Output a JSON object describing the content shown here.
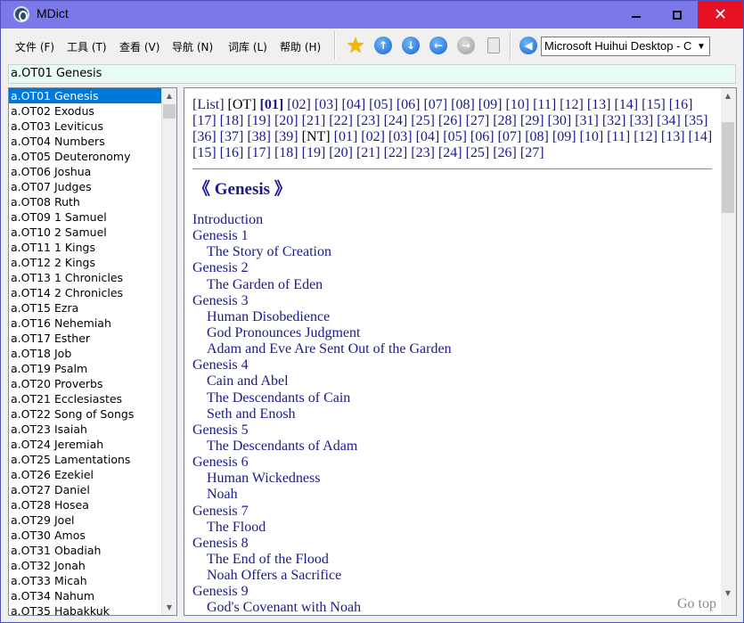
{
  "window": {
    "title": "MDict",
    "close_glyph": "✕"
  },
  "menu": {
    "items": [
      "文件 (F)",
      "工具 (T)",
      "查看 (V)",
      "导航 (N)",
      "词库 (L)",
      "帮助 (H)"
    ]
  },
  "toolbar": {
    "icons": [
      "favorite-star-icon",
      "arrow-up-icon",
      "arrow-down-icon",
      "back-icon",
      "forward-icon",
      "clipboard-icon",
      "speaker-icon"
    ],
    "voice_select": "Microsoft Huihui Desktop - C",
    "dropdown_arrow": "▼",
    "colors": {
      "star": "#f7b500",
      "nav_blue": "#1a63c9",
      "disabled_gray": "#9a9a9a"
    }
  },
  "search": {
    "value": "a.OT01 Genesis"
  },
  "word_list": {
    "selected_index": 0,
    "selected_color": "#0078d7",
    "items": [
      "a.OT01 Genesis",
      "a.OT02 Exodus",
      "a.OT03 Leviticus",
      "a.OT04 Numbers",
      "a.OT05 Deuteronomy",
      "a.OT06 Joshua",
      "a.OT07 Judges",
      "a.OT08 Ruth",
      "a.OT09 1 Samuel",
      "a.OT10 2 Samuel",
      "a.OT11 1 Kings",
      "a.OT12 2 Kings",
      "a.OT13 1 Chronicles",
      "a.OT14 2 Chronicles",
      "a.OT15 Ezra",
      "a.OT16 Nehemiah",
      "a.OT17 Esther",
      "a.OT18 Job",
      "a.OT19 Psalm",
      "a.OT20 Proverbs",
      "a.OT21 Ecclesiastes",
      "a.OT22 Song of Songs",
      "a.OT23 Isaiah",
      "a.OT24 Jeremiah",
      "a.OT25 Lamentations",
      "a.OT26 Ezekiel",
      "a.OT27 Daniel",
      "a.OT28 Hosea",
      "a.OT29 Joel",
      "a.OT30 Amos",
      "a.OT31 Obadiah",
      "a.OT32 Jonah",
      "a.OT33 Micah",
      "a.OT34 Nahum",
      "a.OT35 Habakkuk"
    ]
  },
  "entry": {
    "nav_prefix": "[List]",
    "ot_label": "[OT]",
    "nt_label": "[NT]",
    "current": "[01]",
    "ot_links": [
      "[02]",
      "[03]",
      "[04]",
      "[05]",
      "[06]",
      "[07]",
      "[08]",
      "[09]",
      "[10]",
      "[11]",
      "[12]",
      "[13]",
      "[14]",
      "[15]",
      "[16]",
      "[17]",
      "[18]",
      "[19]",
      "[20]",
      "[21]",
      "[22]",
      "[23]",
      "[24]",
      "[25]",
      "[26]",
      "[27]",
      "[28]",
      "[29]",
      "[30]",
      "[31]",
      "[32]",
      "[33]",
      "[34]",
      "[35]",
      "[36]",
      "[37]",
      "[38]",
      "[39]"
    ],
    "nt_links": [
      "[01]",
      "[02]",
      "[03]",
      "[04]",
      "[05]",
      "[06]",
      "[07]",
      "[08]",
      "[09]",
      "[10]",
      "[11]",
      "[12]",
      "[13]",
      "[14]",
      "[15]",
      "[16]",
      "[17]",
      "[18]",
      "[19]",
      "[20]",
      "[21]",
      "[22]",
      "[23]",
      "[24]",
      "[25]",
      "[26]",
      "[27]"
    ],
    "heading": "《 Genesis 》",
    "toc": [
      {
        "text": "Introduction",
        "level": 0
      },
      {
        "text": "Genesis 1",
        "level": 0
      },
      {
        "text": "The Story of Creation",
        "level": 1
      },
      {
        "text": "Genesis 2",
        "level": 0
      },
      {
        "text": "The Garden of Eden",
        "level": 1
      },
      {
        "text": "Genesis 3",
        "level": 0
      },
      {
        "text": "Human Disobedience",
        "level": 1
      },
      {
        "text": "God Pronounces Judgment",
        "level": 1
      },
      {
        "text": "Adam and Eve Are Sent Out of the Garden",
        "level": 1
      },
      {
        "text": "Genesis 4",
        "level": 0
      },
      {
        "text": "Cain and Abel",
        "level": 1
      },
      {
        "text": "The Descendants of Cain",
        "level": 1
      },
      {
        "text": "Seth and Enosh",
        "level": 1
      },
      {
        "text": "Genesis 5",
        "level": 0
      },
      {
        "text": "The Descendants of Adam",
        "level": 1
      },
      {
        "text": "Genesis 6",
        "level": 0
      },
      {
        "text": "Human Wickedness",
        "level": 1
      },
      {
        "text": "Noah",
        "level": 1
      },
      {
        "text": "Genesis 7",
        "level": 0
      },
      {
        "text": "The Flood",
        "level": 1
      },
      {
        "text": "Genesis 8",
        "level": 0
      },
      {
        "text": "The End of the Flood",
        "level": 1
      },
      {
        "text": "Noah Offers a Sacrifice",
        "level": 1
      },
      {
        "text": "Genesis 9",
        "level": 0
      },
      {
        "text": "God's Covenant with Noah",
        "level": 1
      }
    ],
    "go_top": "Go top",
    "link_color": "#1a1a8c"
  }
}
